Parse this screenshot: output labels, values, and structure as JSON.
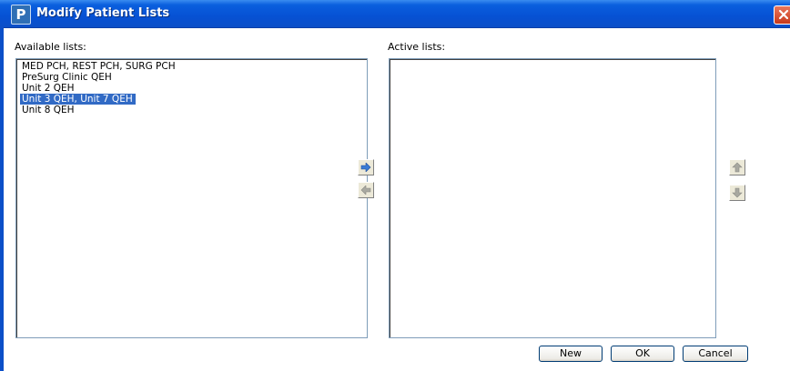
{
  "window": {
    "title": "Modify Patient Lists",
    "app_icon_letter": "P"
  },
  "available": {
    "label": "Available lists:",
    "items": [
      {
        "label": "MED PCH, REST PCH, SURG PCH",
        "selected": false
      },
      {
        "label": "PreSurg Clinic QEH",
        "selected": false
      },
      {
        "label": "Unit 2 QEH",
        "selected": false
      },
      {
        "label": "Unit 3 QEH, Unit 7 QEH",
        "selected": true
      },
      {
        "label": "Unit 8 QEH",
        "selected": false
      }
    ]
  },
  "active": {
    "label": "Active lists:",
    "items": []
  },
  "transfer_buttons": {
    "add_icon": "right-arrow-icon",
    "remove_icon": "left-arrow-icon"
  },
  "order_buttons": {
    "up_icon": "up-arrow-icon",
    "down_icon": "down-arrow-icon"
  },
  "footer": {
    "new_label": "New",
    "ok_label": "OK",
    "cancel_label": "Cancel"
  },
  "colors": {
    "titlebar": "#0651d4",
    "selection": "#316ac5",
    "arrow_active": "#3a7bd5",
    "arrow_disabled": "#a8a8a0"
  }
}
